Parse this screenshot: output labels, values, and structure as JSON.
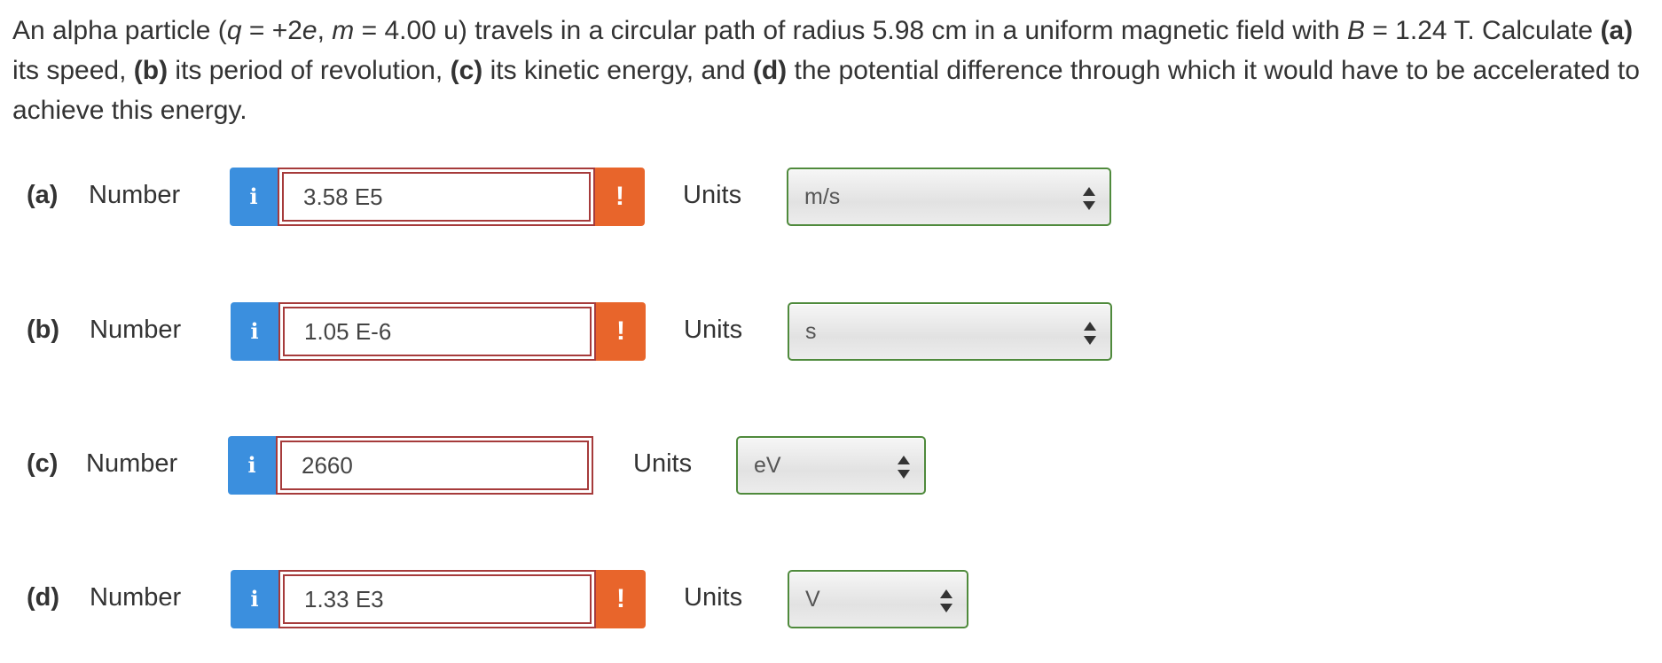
{
  "question": {
    "intro": "An alpha particle (",
    "q_var": "q",
    "q_val": " = +2",
    "e_var": "e",
    "comma_m": ", ",
    "m_var": "m",
    "m_val": " = 4.00 u) travels in a circular path of radius 5.98 cm in a uniform magnetic field with ",
    "b_var": "B",
    "b_val": " = 1.24 T. Calculate ",
    "a_label": "(a)",
    "a_text": " its speed, ",
    "b_label": "(b)",
    "b_text": " its period of revolution, ",
    "c_label": "(c)",
    "c_text": " its kinetic energy, and ",
    "d_label": "(d)",
    "d_text": " the potential difference through which it would have to be accelerated to achieve this energy."
  },
  "parts": [
    {
      "label": "(a)",
      "number_label": "Number",
      "info_icon": "i",
      "answer": "3.58 E5",
      "warning_icon": "!",
      "units_label": "Units",
      "unit": "m/s"
    },
    {
      "label": "(b)",
      "number_label": "Number",
      "info_icon": "i",
      "answer": "1.05 E-6",
      "warning_icon": "!",
      "units_label": "Units",
      "unit": "s"
    },
    {
      "label": "(c)",
      "number_label": "Number",
      "info_icon": "i",
      "answer": "2660",
      "units_label": "Units",
      "unit": "eV"
    },
    {
      "label": "(d)",
      "number_label": "Number",
      "info_icon": "i",
      "answer": "1.33 E3",
      "warning_icon": "!",
      "units_label": "Units",
      "unit": "V"
    }
  ],
  "colors": {
    "info": "#3b8fde",
    "warning": "#e8652b",
    "answer_border": "#a63b3b",
    "select_border": "#4f8a3c"
  }
}
